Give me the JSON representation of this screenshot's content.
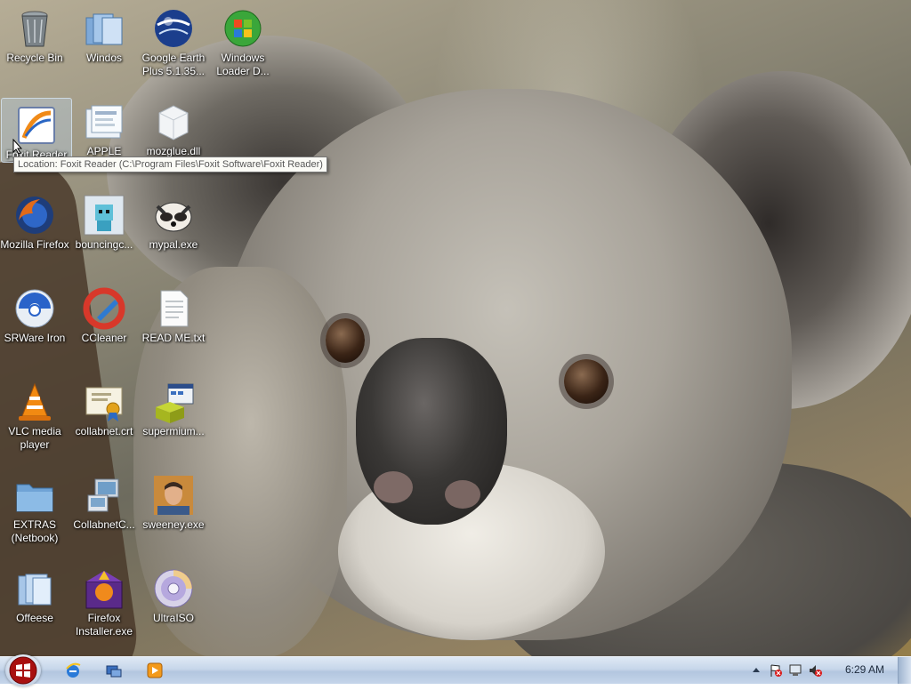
{
  "desktop": {
    "icons": [
      {
        "label": "Recycle Bin",
        "icon": "recycle-bin-icon"
      },
      {
        "label": "Windos",
        "icon": "folder-libraries-icon"
      },
      {
        "label": "Google Earth Plus 5.1.35...",
        "icon": "google-earth-icon"
      },
      {
        "label": "Windows Loader D...",
        "icon": "windows-loader-icon"
      },
      {
        "label": "Foxit Reader",
        "icon": "foxit-reader-icon"
      },
      {
        "label": "APPLE",
        "icon": "apple-folder-icon"
      },
      {
        "label": "mozglue.dll",
        "icon": "dll-file-icon"
      },
      {
        "label": "Mozilla Firefox",
        "icon": "firefox-icon"
      },
      {
        "label": "bouncingc...",
        "icon": "bouncingc-image-icon"
      },
      {
        "label": "mypal.exe",
        "icon": "mypal-icon"
      },
      {
        "label": "SRWare Iron",
        "icon": "srware-iron-icon"
      },
      {
        "label": "CCleaner",
        "icon": "ccleaner-icon"
      },
      {
        "label": "READ ME.txt",
        "icon": "text-file-icon"
      },
      {
        "label": "VLC media player",
        "icon": "vlc-icon"
      },
      {
        "label": "collabnet.crt",
        "icon": "certificate-icon"
      },
      {
        "label": "supermium...",
        "icon": "installer-icon"
      },
      {
        "label": "EXTRAS (Netbook)",
        "icon": "folder-icon"
      },
      {
        "label": "CollabnetC...",
        "icon": "collabnet-icon"
      },
      {
        "label": "sweeney.exe",
        "icon": "sweeney-photo-icon"
      },
      {
        "label": "Offeese",
        "icon": "folder-libraries-icon"
      },
      {
        "label": "Firefox Installer.exe",
        "icon": "firefox-installer-icon"
      },
      {
        "label": "UltraISO",
        "icon": "ultraiso-icon"
      }
    ]
  },
  "tooltip": {
    "text": "Location: Foxit Reader (C:\\Program Files\\Foxit Software\\Foxit Reader)"
  },
  "taskbar": {
    "start": "start-button-icon",
    "quick_launch": [
      "internet-explorer-icon",
      "show-desktop-icon",
      "media-player-icon"
    ],
    "tray": [
      "show-hidden-icons-chevron",
      "action-center-flag-icon",
      "network-icon",
      "volume-muted-icon"
    ],
    "clock": "6:29 AM"
  }
}
